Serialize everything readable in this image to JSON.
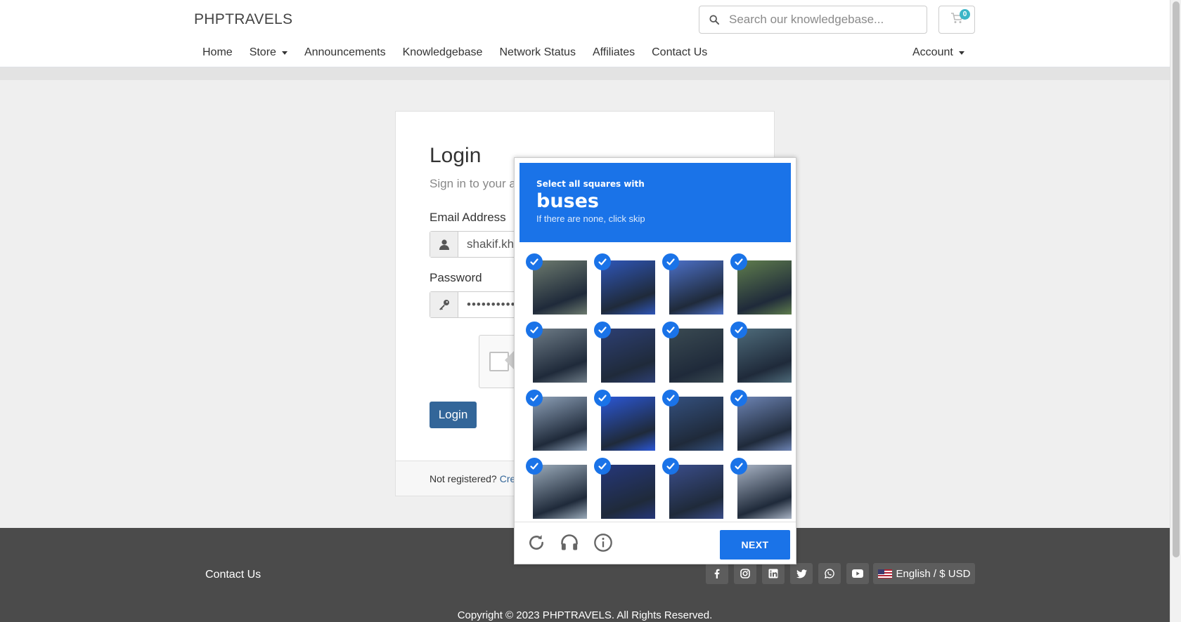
{
  "header": {
    "brand": "PHPTRAVELS",
    "search_placeholder": "Search our knowledgebase...",
    "cart_count": "0",
    "nav": [
      {
        "label": "Home",
        "caret": false
      },
      {
        "label": "Store",
        "caret": true
      },
      {
        "label": "Announcements",
        "caret": false
      },
      {
        "label": "Knowledgebase",
        "caret": false
      },
      {
        "label": "Network Status",
        "caret": false
      },
      {
        "label": "Affiliates",
        "caret": false
      },
      {
        "label": "Contact Us",
        "caret": false
      }
    ],
    "account_label": "Account"
  },
  "login": {
    "title": "Login",
    "subtitle": "Sign in to your a",
    "email_label": "Email Address",
    "email_value": "shakif.kh",
    "password_label": "Password",
    "password_value": "••••••••••",
    "button_label": "Login",
    "footer_text": "Not registered?",
    "footer_link": "Crea"
  },
  "footer": {
    "contact": "Contact Us",
    "socials": [
      "facebook-icon",
      "instagram-icon",
      "linkedin-icon",
      "twitter-icon",
      "whatsapp-icon",
      "youtube-icon"
    ],
    "language": "English / $ USD",
    "copyright": "Copyright © 2023 PHPTRAVELS. All Rights Reserved."
  },
  "captcha": {
    "instruction": "Select all squares with",
    "target": "buses",
    "hint": "If there are none, click skip",
    "next_label": "NEXT",
    "accent": "#1a73e8",
    "tiles": [
      {
        "selected": true,
        "tone": "#6c7a6e"
      },
      {
        "selected": true,
        "tone": "#2f56b8"
      },
      {
        "selected": true,
        "tone": "#4c70c8"
      },
      {
        "selected": true,
        "tone": "#5f7d4d"
      },
      {
        "selected": true,
        "tone": "#6d7b86"
      },
      {
        "selected": true,
        "tone": "#2d3f73"
      },
      {
        "selected": true,
        "tone": "#3a4a52"
      },
      {
        "selected": true,
        "tone": "#4e6b7a"
      },
      {
        "selected": true,
        "tone": "#8da0b7"
      },
      {
        "selected": true,
        "tone": "#2b57d6"
      },
      {
        "selected": true,
        "tone": "#34507e"
      },
      {
        "selected": true,
        "tone": "#6d84b4"
      },
      {
        "selected": true,
        "tone": "#9aaab9"
      },
      {
        "selected": true,
        "tone": "#25377a"
      },
      {
        "selected": true,
        "tone": "#3a4d8a"
      },
      {
        "selected": true,
        "tone": "#a8b3c4"
      }
    ]
  }
}
